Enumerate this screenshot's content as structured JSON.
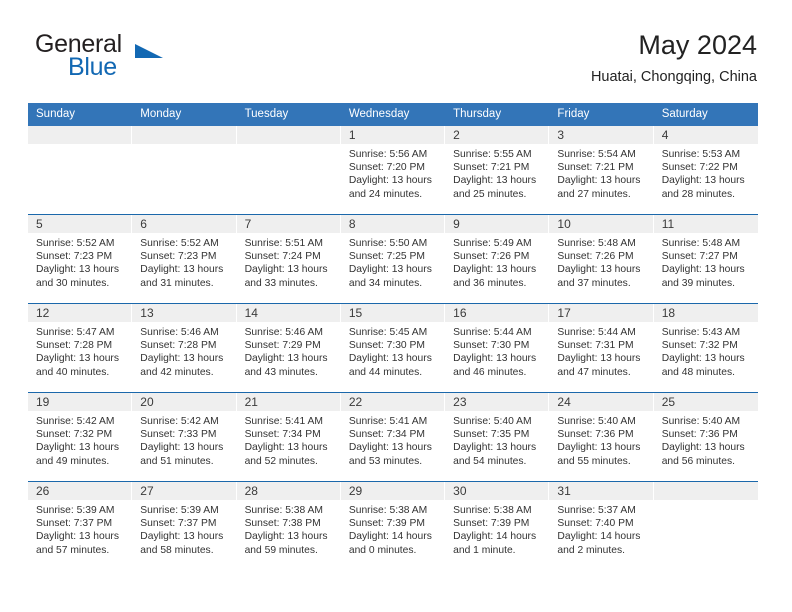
{
  "brand": {
    "name_part1": "General",
    "name_part2": "Blue",
    "logo_icon": "triangle-flag-icon",
    "accent_color": "#1268b3"
  },
  "header": {
    "title": "May 2024",
    "subtitle": "Huatai, Chongqing, China"
  },
  "calendar": {
    "header_bg": "#3375b8",
    "row_divider_color": "#1b68ab",
    "day_band_bg": "#efefef",
    "weekdays": [
      "Sunday",
      "Monday",
      "Tuesday",
      "Wednesday",
      "Thursday",
      "Friday",
      "Saturday"
    ],
    "weeks": [
      [
        {
          "day": "",
          "empty": true
        },
        {
          "day": "",
          "empty": true
        },
        {
          "day": "",
          "empty": true
        },
        {
          "day": "1",
          "sunrise": "Sunrise: 5:56 AM",
          "sunset": "Sunset: 7:20 PM",
          "daylight_line1": "Daylight: 13 hours",
          "daylight_line2": "and 24 minutes."
        },
        {
          "day": "2",
          "sunrise": "Sunrise: 5:55 AM",
          "sunset": "Sunset: 7:21 PM",
          "daylight_line1": "Daylight: 13 hours",
          "daylight_line2": "and 25 minutes."
        },
        {
          "day": "3",
          "sunrise": "Sunrise: 5:54 AM",
          "sunset": "Sunset: 7:21 PM",
          "daylight_line1": "Daylight: 13 hours",
          "daylight_line2": "and 27 minutes."
        },
        {
          "day": "4",
          "sunrise": "Sunrise: 5:53 AM",
          "sunset": "Sunset: 7:22 PM",
          "daylight_line1": "Daylight: 13 hours",
          "daylight_line2": "and 28 minutes."
        }
      ],
      [
        {
          "day": "5",
          "sunrise": "Sunrise: 5:52 AM",
          "sunset": "Sunset: 7:23 PM",
          "daylight_line1": "Daylight: 13 hours",
          "daylight_line2": "and 30 minutes."
        },
        {
          "day": "6",
          "sunrise": "Sunrise: 5:52 AM",
          "sunset": "Sunset: 7:23 PM",
          "daylight_line1": "Daylight: 13 hours",
          "daylight_line2": "and 31 minutes."
        },
        {
          "day": "7",
          "sunrise": "Sunrise: 5:51 AM",
          "sunset": "Sunset: 7:24 PM",
          "daylight_line1": "Daylight: 13 hours",
          "daylight_line2": "and 33 minutes."
        },
        {
          "day": "8",
          "sunrise": "Sunrise: 5:50 AM",
          "sunset": "Sunset: 7:25 PM",
          "daylight_line1": "Daylight: 13 hours",
          "daylight_line2": "and 34 minutes."
        },
        {
          "day": "9",
          "sunrise": "Sunrise: 5:49 AM",
          "sunset": "Sunset: 7:26 PM",
          "daylight_line1": "Daylight: 13 hours",
          "daylight_line2": "and 36 minutes."
        },
        {
          "day": "10",
          "sunrise": "Sunrise: 5:48 AM",
          "sunset": "Sunset: 7:26 PM",
          "daylight_line1": "Daylight: 13 hours",
          "daylight_line2": "and 37 minutes."
        },
        {
          "day": "11",
          "sunrise": "Sunrise: 5:48 AM",
          "sunset": "Sunset: 7:27 PM",
          "daylight_line1": "Daylight: 13 hours",
          "daylight_line2": "and 39 minutes."
        }
      ],
      [
        {
          "day": "12",
          "sunrise": "Sunrise: 5:47 AM",
          "sunset": "Sunset: 7:28 PM",
          "daylight_line1": "Daylight: 13 hours",
          "daylight_line2": "and 40 minutes."
        },
        {
          "day": "13",
          "sunrise": "Sunrise: 5:46 AM",
          "sunset": "Sunset: 7:28 PM",
          "daylight_line1": "Daylight: 13 hours",
          "daylight_line2": "and 42 minutes."
        },
        {
          "day": "14",
          "sunrise": "Sunrise: 5:46 AM",
          "sunset": "Sunset: 7:29 PM",
          "daylight_line1": "Daylight: 13 hours",
          "daylight_line2": "and 43 minutes."
        },
        {
          "day": "15",
          "sunrise": "Sunrise: 5:45 AM",
          "sunset": "Sunset: 7:30 PM",
          "daylight_line1": "Daylight: 13 hours",
          "daylight_line2": "and 44 minutes."
        },
        {
          "day": "16",
          "sunrise": "Sunrise: 5:44 AM",
          "sunset": "Sunset: 7:30 PM",
          "daylight_line1": "Daylight: 13 hours",
          "daylight_line2": "and 46 minutes."
        },
        {
          "day": "17",
          "sunrise": "Sunrise: 5:44 AM",
          "sunset": "Sunset: 7:31 PM",
          "daylight_line1": "Daylight: 13 hours",
          "daylight_line2": "and 47 minutes."
        },
        {
          "day": "18",
          "sunrise": "Sunrise: 5:43 AM",
          "sunset": "Sunset: 7:32 PM",
          "daylight_line1": "Daylight: 13 hours",
          "daylight_line2": "and 48 minutes."
        }
      ],
      [
        {
          "day": "19",
          "sunrise": "Sunrise: 5:42 AM",
          "sunset": "Sunset: 7:32 PM",
          "daylight_line1": "Daylight: 13 hours",
          "daylight_line2": "and 49 minutes."
        },
        {
          "day": "20",
          "sunrise": "Sunrise: 5:42 AM",
          "sunset": "Sunset: 7:33 PM",
          "daylight_line1": "Daylight: 13 hours",
          "daylight_line2": "and 51 minutes."
        },
        {
          "day": "21",
          "sunrise": "Sunrise: 5:41 AM",
          "sunset": "Sunset: 7:34 PM",
          "daylight_line1": "Daylight: 13 hours",
          "daylight_line2": "and 52 minutes."
        },
        {
          "day": "22",
          "sunrise": "Sunrise: 5:41 AM",
          "sunset": "Sunset: 7:34 PM",
          "daylight_line1": "Daylight: 13 hours",
          "daylight_line2": "and 53 minutes."
        },
        {
          "day": "23",
          "sunrise": "Sunrise: 5:40 AM",
          "sunset": "Sunset: 7:35 PM",
          "daylight_line1": "Daylight: 13 hours",
          "daylight_line2": "and 54 minutes."
        },
        {
          "day": "24",
          "sunrise": "Sunrise: 5:40 AM",
          "sunset": "Sunset: 7:36 PM",
          "daylight_line1": "Daylight: 13 hours",
          "daylight_line2": "and 55 minutes."
        },
        {
          "day": "25",
          "sunrise": "Sunrise: 5:40 AM",
          "sunset": "Sunset: 7:36 PM",
          "daylight_line1": "Daylight: 13 hours",
          "daylight_line2": "and 56 minutes."
        }
      ],
      [
        {
          "day": "26",
          "sunrise": "Sunrise: 5:39 AM",
          "sunset": "Sunset: 7:37 PM",
          "daylight_line1": "Daylight: 13 hours",
          "daylight_line2": "and 57 minutes."
        },
        {
          "day": "27",
          "sunrise": "Sunrise: 5:39 AM",
          "sunset": "Sunset: 7:37 PM",
          "daylight_line1": "Daylight: 13 hours",
          "daylight_line2": "and 58 minutes."
        },
        {
          "day": "28",
          "sunrise": "Sunrise: 5:38 AM",
          "sunset": "Sunset: 7:38 PM",
          "daylight_line1": "Daylight: 13 hours",
          "daylight_line2": "and 59 minutes."
        },
        {
          "day": "29",
          "sunrise": "Sunrise: 5:38 AM",
          "sunset": "Sunset: 7:39 PM",
          "daylight_line1": "Daylight: 14 hours",
          "daylight_line2": "and 0 minutes."
        },
        {
          "day": "30",
          "sunrise": "Sunrise: 5:38 AM",
          "sunset": "Sunset: 7:39 PM",
          "daylight_line1": "Daylight: 14 hours",
          "daylight_line2": "and 1 minute."
        },
        {
          "day": "31",
          "sunrise": "Sunrise: 5:37 AM",
          "sunset": "Sunset: 7:40 PM",
          "daylight_line1": "Daylight: 14 hours",
          "daylight_line2": "and 2 minutes."
        },
        {
          "day": "",
          "empty": true
        }
      ]
    ]
  }
}
